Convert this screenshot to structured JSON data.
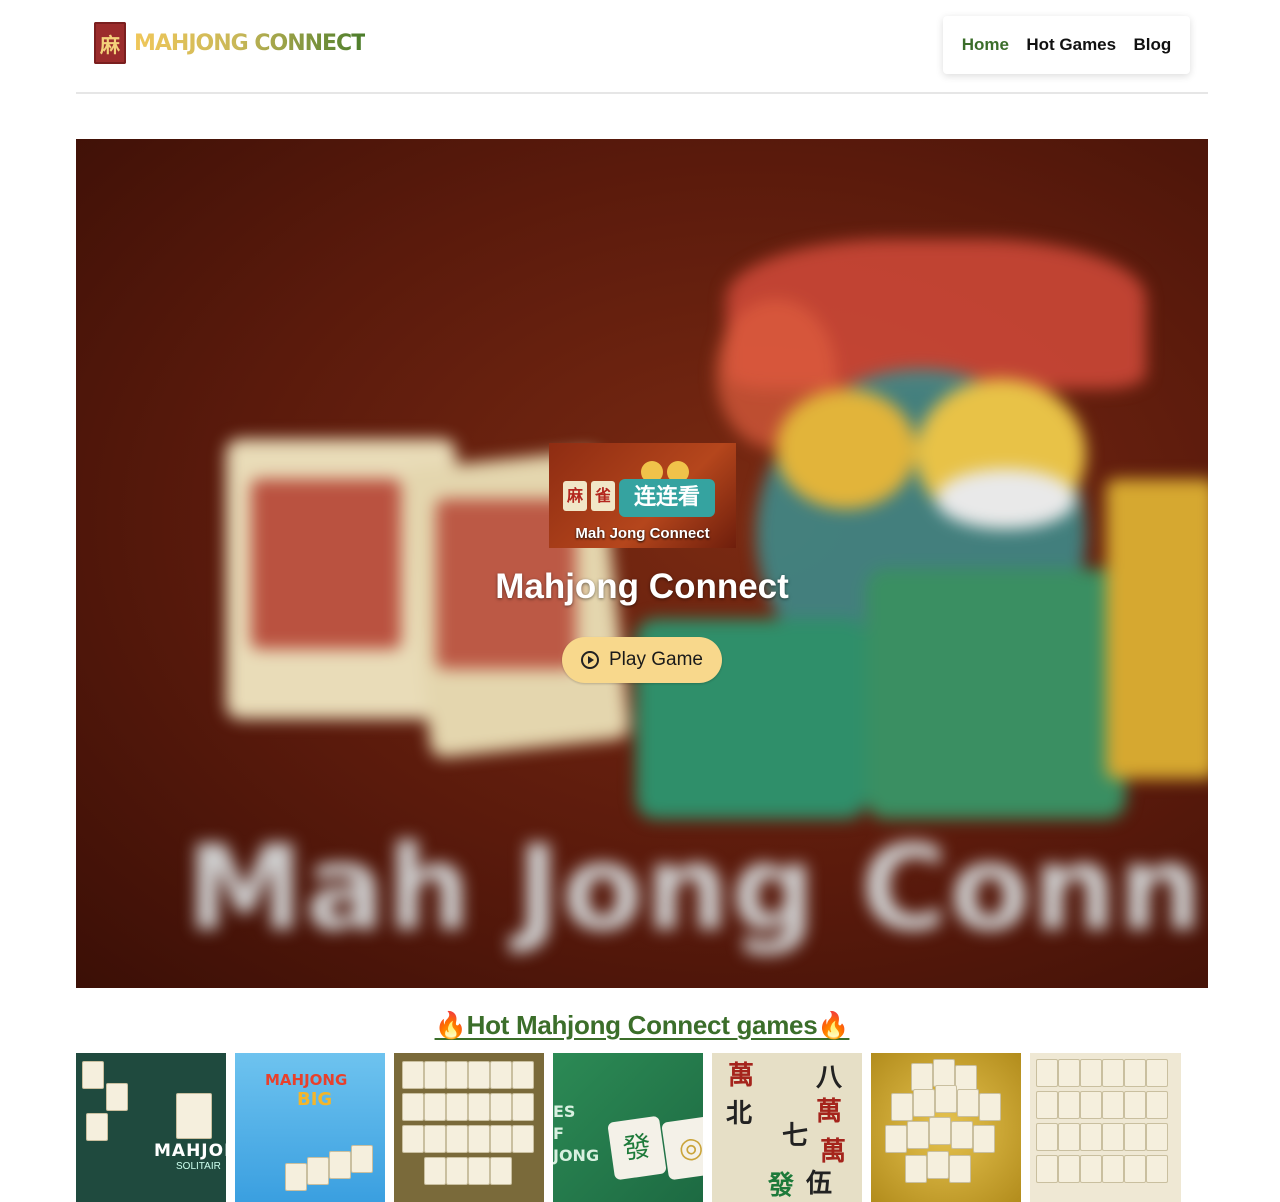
{
  "header": {
    "logo_mark": "麻",
    "logo_text": "MAHJONG CONNECT",
    "nav": [
      {
        "label": "Home",
        "active": true
      },
      {
        "label": "Hot Games",
        "active": false
      },
      {
        "label": "Blog",
        "active": false
      }
    ]
  },
  "hero": {
    "background_text": "Mah Jong Conn",
    "thumb_tiles": [
      "麻",
      "雀"
    ],
    "thumb_title": "连连看",
    "thumb_caption": "Mah Jong Connect",
    "title": "Mahjong Connect",
    "play_label": "Play Game"
  },
  "hot_games": {
    "title": "🔥Hot Mahjong Connect games🔥",
    "games": [
      {
        "label": "MAHJON",
        "sub": "SOLITAIR",
        "accent": "#1f4a3e"
      },
      {
        "label": "MAHJONG",
        "label2": "BIG",
        "accent": "#3a9fe0"
      },
      {
        "accent": "#7a6a3a"
      },
      {
        "label": "ES\nF\nJONG",
        "tile": "發",
        "accent": "#2c8a55"
      },
      {
        "chars": [
          "萬",
          "八",
          "北",
          "七",
          "萬",
          "萬",
          "伍",
          "發"
        ],
        "accent": "#e6dfc6"
      },
      {
        "accent": "#e6c350"
      },
      {
        "accent": "#efe8d4"
      }
    ]
  }
}
